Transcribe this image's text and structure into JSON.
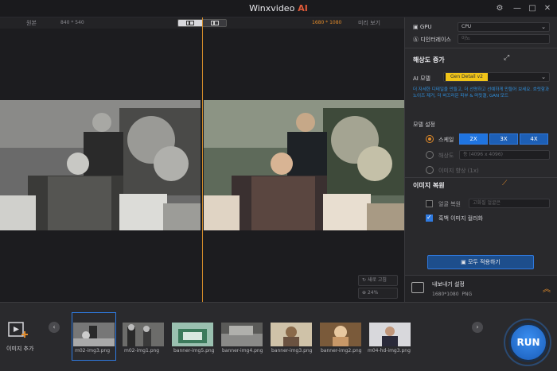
{
  "app": {
    "title": "Winxvideo",
    "title_ai": "AI"
  },
  "window_controls": {
    "settings_icon": "gear-icon",
    "minimize": "—",
    "maximize": "□",
    "close": "✕"
  },
  "preview_header": {
    "original_label": "원본",
    "original_dims": "840 * 540",
    "output_dims": "1680 * 1080",
    "preview_label": "미리 보기"
  },
  "preview_buttons": {
    "refresh": "새로 고침",
    "zoom": "24%"
  },
  "panel": {
    "gpu_label": "GPU",
    "gpu_value": "CPU",
    "deinterlace_label": "디인터레이스",
    "deinterlace_value": "아뇨",
    "upscale_title": "해상도 증가",
    "ai_model_label": "AI 모델",
    "ai_model_value": "Gen Detail v2",
    "model_desc": "더 자세한 디테일을 만들고, 더 선명하고 선예하게 만들어 보세요. 흐릿함과 노이즈 제거, 더 버끄러운 피부 & 머릿결, GAN 모드",
    "model_settings_label": "모델 설정",
    "scale_label": "스케일",
    "scale_options": [
      "2X",
      "3X",
      "4X"
    ],
    "resolution_label": "해상도",
    "resolution_placeholder": "등 (4096 x 4096)",
    "image_enhance_label": "이미지 향상 (1x)",
    "restore_title": "이미지 복원",
    "face_restore_label": "얼굴 복원",
    "face_restore_value": "고화질 얼굴은",
    "colorize_label": "흑백 이미지 컬러화",
    "apply_all": "모두 적용하기",
    "export_title": "내보내기 설정",
    "export_dims": "1680*1080",
    "export_format": "PNG"
  },
  "bottom": {
    "add_image": "이미지 추가",
    "thumbnails": [
      {
        "name": "m02-img3.png"
      },
      {
        "name": "m02-img1.png"
      },
      {
        "name": "banner-img5.png"
      },
      {
        "name": "banner-img4.png"
      },
      {
        "name": "banner-img3.png"
      },
      {
        "name": "banner-img2.png"
      },
      {
        "name": "m04-hd-img3.png"
      }
    ],
    "run": "RUN"
  },
  "colors": {
    "accent_orange": "#e08a2a",
    "accent_blue": "#2f7ae0",
    "ai_red": "#e25b3a",
    "model_yellow": "#f0c419"
  }
}
